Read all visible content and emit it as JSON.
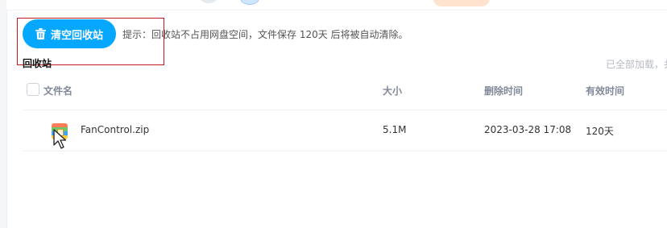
{
  "toolbar": {
    "clear_button_label": "清空回收站",
    "tip": "提示：回收站不占用网盘空间，文件保存 120天 后将被自动清除。"
  },
  "section": {
    "title": "回收站",
    "loaded_note": "已全部加载，共"
  },
  "table": {
    "columns": [
      "文件名",
      "大小",
      "删除时间",
      "有效时间"
    ],
    "rows": [
      {
        "name": "FanControl.zip",
        "size": "5.1M",
        "deleted_at": "2023-03-28 17:08",
        "valid": "120天",
        "icon": "zip-file-icon"
      }
    ]
  },
  "colors": {
    "primary": "#06a7ff",
    "highlight_box": "#c0191f"
  }
}
